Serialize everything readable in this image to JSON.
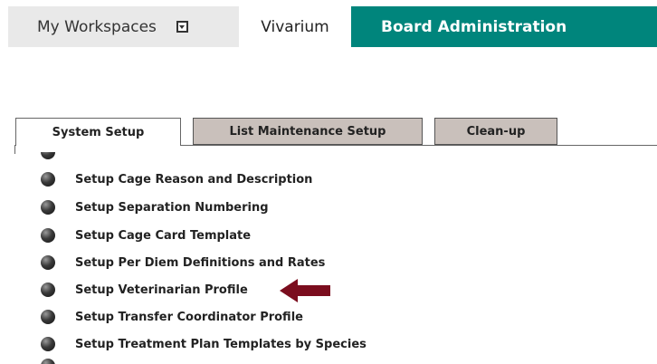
{
  "topnav": {
    "workspaces_label": "My Workspaces",
    "vivarium_label": "Vivarium",
    "board_label": "Board Administration"
  },
  "colors": {
    "accent": "#00857c",
    "tab_inactive": "#c9c0bb",
    "arrow": "#7b0d1e"
  },
  "tabs": [
    {
      "label": "System Setup",
      "active": true
    },
    {
      "label": "List Maintenance Setup",
      "active": false
    },
    {
      "label": "Clean-up",
      "active": false
    }
  ],
  "list": {
    "items": [
      {
        "label": "Setup Cage Reason and Description"
      },
      {
        "label": "Setup Separation Numbering"
      },
      {
        "label": "Setup Cage Card Template"
      },
      {
        "label": "Setup Per Diem Definitions and Rates"
      },
      {
        "label": "Setup Veterinarian Profile"
      },
      {
        "label": "Setup Transfer Coordinator Profile"
      },
      {
        "label": "Setup Treatment Plan Templates by Species"
      }
    ]
  },
  "annotation": {
    "icon": "arrow-left-icon"
  }
}
